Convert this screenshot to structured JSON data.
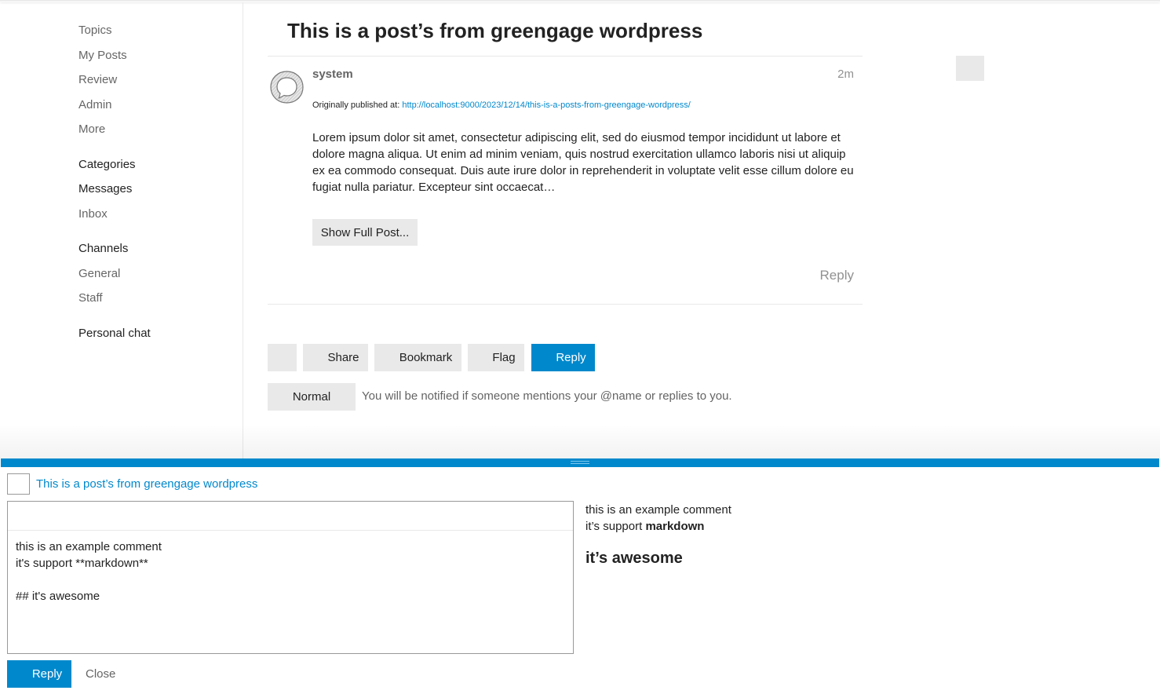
{
  "sidebar": {
    "items": [
      {
        "label": "Topics"
      },
      {
        "label": "My Posts"
      },
      {
        "label": "Review"
      },
      {
        "label": "Admin"
      },
      {
        "label": "More"
      }
    ],
    "categories_label": "Categories",
    "messages_label": "Messages",
    "inbox_label": "Inbox",
    "channels_label": "Channels",
    "channels": [
      {
        "label": "General"
      },
      {
        "label": "Staff"
      }
    ],
    "personal_chat_label": "Personal chat"
  },
  "topic": {
    "title": "This is a post’s from greengage wordpress"
  },
  "post": {
    "avatar_icon": "speech-bubble-icon",
    "username": "system",
    "date": "2m",
    "originally_published_label": "Originally published at:",
    "original_url": "http://localhost:9000/2023/12/14/this-is-a-posts-from-greengage-wordpress/",
    "body": "Lorem ipsum dolor sit amet, consectetur adipiscing elit, sed do eiusmod tempor incididunt ut labore et dolore magna aliqua. Ut enim ad minim veniam, quis nostrud exercitation ullamco laboris nisi ut aliquip ex ea commodo consequat. Duis aute irure dolor in reprehenderit in voluptate velit esse cillum dolore eu fugiat nulla pariatur. Excepteur sint occaecat…",
    "show_full_label": "Show Full Post...",
    "reply_label": "Reply"
  },
  "footer_buttons": {
    "share": "Share",
    "bookmark": "Bookmark",
    "flag": "Flag",
    "reply": "Reply"
  },
  "notifications": {
    "level": "Normal",
    "description": "You will be notified if someone mentions your @name or replies to you."
  },
  "composer": {
    "reply_to_title": "This is a post’s from greengage wordpress",
    "text": "this is an example comment\nit's support **markdown**\n\n## it's awesome",
    "preview": {
      "line1": "this is an example comment",
      "line2_prefix": "it’s support ",
      "line2_bold": "markdown",
      "heading": "it’s awesome"
    },
    "reply_label": "Reply",
    "close_label": "Close"
  },
  "colors": {
    "accent": "#0088cc",
    "button_bg": "#e9e9e9",
    "muted_text": "#646464"
  }
}
